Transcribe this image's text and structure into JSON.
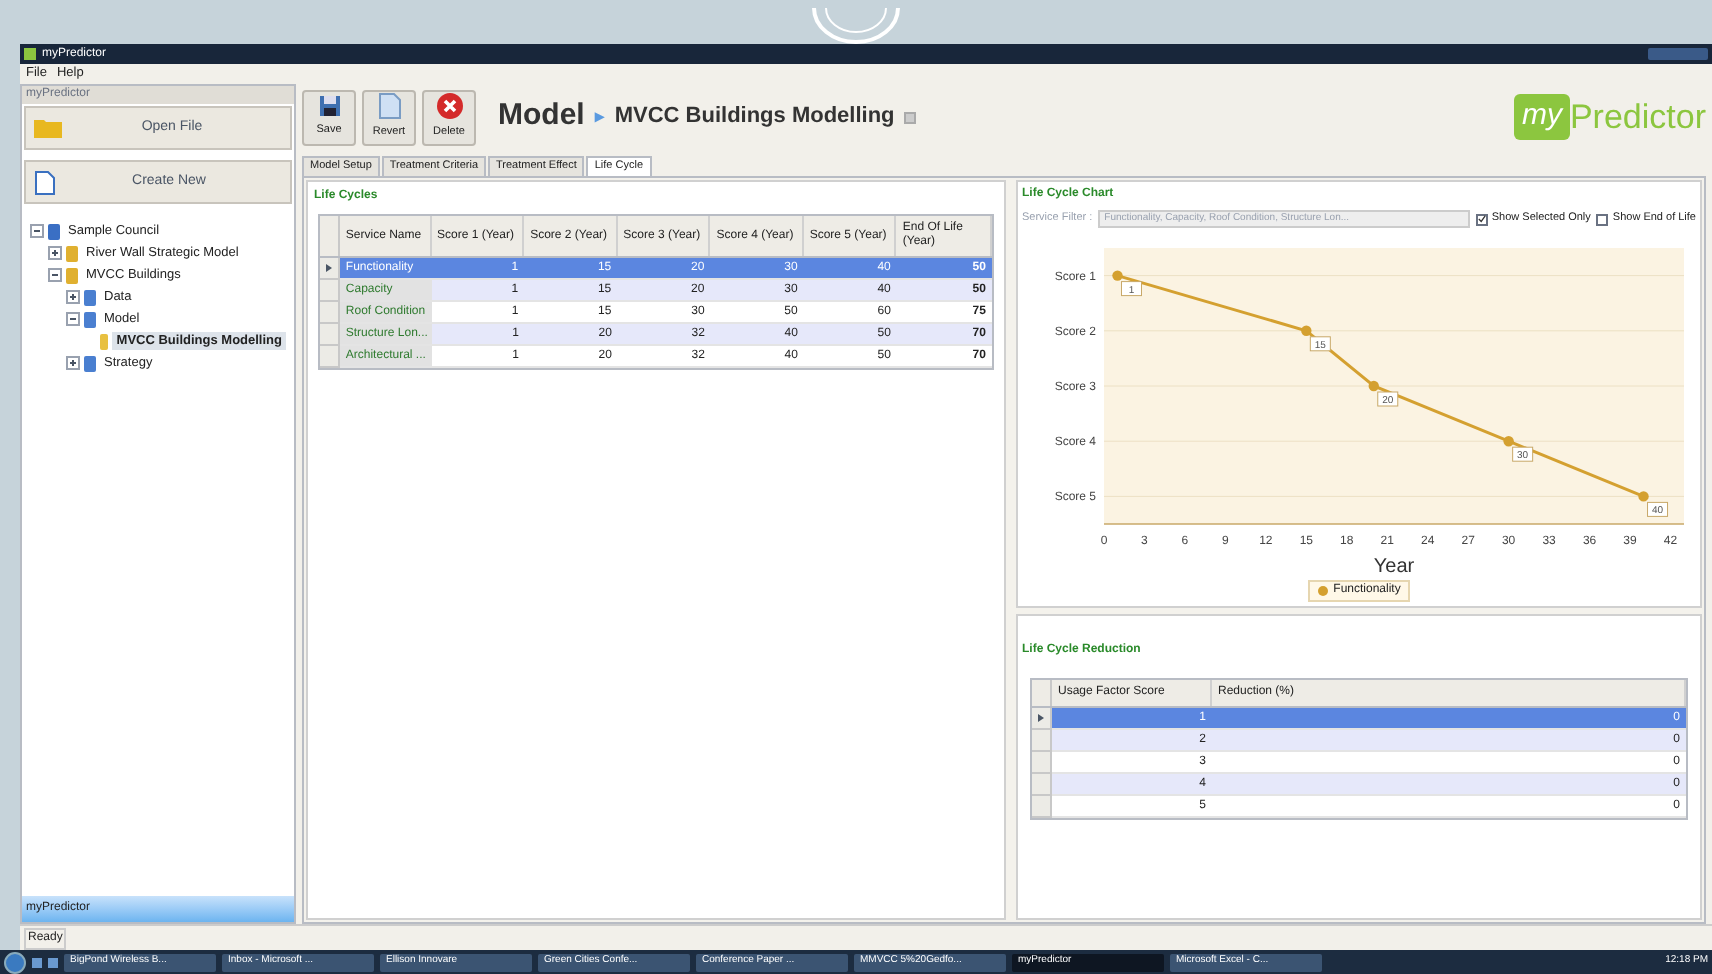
{
  "window": {
    "title": "myPredictor"
  },
  "menu": [
    {
      "label": "File"
    },
    {
      "label": "Help"
    }
  ],
  "sidebar": {
    "header": "myPredictor",
    "open_button": "Open File",
    "create_button": "Create New",
    "footer": "myPredictor",
    "tree": [
      {
        "label": "Sample Council",
        "kind": "root",
        "expanded": true,
        "selected": false,
        "children": [
          {
            "label": "River Wall Strategic Model",
            "kind": "folder",
            "expanded": false,
            "selected": false
          },
          {
            "label": "MVCC Buildings",
            "kind": "folder",
            "expanded": true,
            "selected": false,
            "children": [
              {
                "label": "Data",
                "kind": "group",
                "expanded": false,
                "selected": false
              },
              {
                "label": "Model",
                "kind": "group",
                "expanded": true,
                "selected": false,
                "children": [
                  {
                    "label": "MVCC Buildings Modelling",
                    "kind": "doc",
                    "expanded": false,
                    "selected": true
                  }
                ]
              },
              {
                "label": "Strategy",
                "kind": "group",
                "expanded": false,
                "selected": false
              }
            ]
          }
        ]
      }
    ]
  },
  "toolbar": [
    {
      "label": "Save",
      "kind": "save"
    },
    {
      "label": "Revert",
      "kind": "revert"
    },
    {
      "label": "Delete",
      "kind": "delete"
    }
  ],
  "breadcrumb": {
    "section": "Model",
    "separator": "▸",
    "page": "MVCC Buildings Modelling"
  },
  "logo": {
    "prefix": "my",
    "name": "Predictor"
  },
  "tabs": [
    {
      "label": "Model Setup",
      "selected": false
    },
    {
      "label": "Treatment Criteria",
      "selected": false
    },
    {
      "label": "Treatment Effect",
      "selected": false
    },
    {
      "label": "Life Cycle",
      "selected": true
    }
  ],
  "life_cycles": {
    "title": "Life Cycles",
    "columns": [
      "Service Name",
      "Score 1 (Year)",
      "Score 2 (Year)",
      "Score 3 (Year)",
      "Score 4 (Year)",
      "Score 5 (Year)",
      "End Of Life (Year)"
    ],
    "rows": [
      {
        "selected": true,
        "cells": [
          "Functionality",
          "1",
          "15",
          "20",
          "30",
          "40",
          "50"
        ]
      },
      {
        "selected": false,
        "cells": [
          "Capacity",
          "1",
          "15",
          "20",
          "30",
          "40",
          "50"
        ]
      },
      {
        "selected": false,
        "cells": [
          "Roof Condition",
          "1",
          "15",
          "30",
          "50",
          "60",
          "75"
        ]
      },
      {
        "selected": false,
        "cells": [
          "Structure Lon...",
          "1",
          "20",
          "32",
          "40",
          "50",
          "70"
        ]
      },
      {
        "selected": false,
        "cells": [
          "Architectural ...",
          "1",
          "20",
          "32",
          "40",
          "50",
          "70"
        ]
      }
    ]
  },
  "life_cycle_chart": {
    "title": "Life Cycle Chart",
    "filter_label": "Service Filter :",
    "filter_value": "Functionality, Capacity, Roof Condition, Structure Lon...",
    "filter_disabled": true,
    "options": [
      {
        "label": "Show Selected Only",
        "checked": true
      },
      {
        "label": "Show End of Life",
        "checked": false
      }
    ],
    "chart_data": {
      "type": "line",
      "orientation": "horizontal",
      "xlabel": "Year",
      "categories": [
        "Score 1",
        "Score 2",
        "Score 3",
        "Score 4",
        "Score 5"
      ],
      "series": [
        {
          "name": "Functionality",
          "color": "#d4a030",
          "marker": "circle",
          "values": [
            1,
            15,
            20,
            30,
            40
          ]
        }
      ],
      "grid": true,
      "xlim": [
        0,
        43
      ],
      "xticks": [
        0,
        3,
        6,
        9,
        12,
        15,
        18,
        21,
        24,
        27,
        30,
        33,
        36,
        39,
        42
      ],
      "data_labels": true
    }
  },
  "life_cycle_reduction": {
    "title": "Life Cycle Reduction",
    "columns": [
      "Usage Factor Score",
      "Reduction (%)"
    ],
    "rows": [
      {
        "selected": true,
        "cells": [
          "1",
          "0"
        ]
      },
      {
        "selected": false,
        "cells": [
          "2",
          "0"
        ]
      },
      {
        "selected": false,
        "cells": [
          "3",
          "0"
        ]
      },
      {
        "selected": false,
        "cells": [
          "4",
          "0"
        ]
      },
      {
        "selected": false,
        "cells": [
          "5",
          "0"
        ]
      }
    ]
  },
  "status_bar": "Ready",
  "taskbar": {
    "items": [
      {
        "label": "BigPond Wireless B...",
        "selected": false
      },
      {
        "label": "Inbox - Microsoft ...",
        "selected": false
      },
      {
        "label": "Ellison Innovare",
        "selected": false
      },
      {
        "label": "Green Cities Confe...",
        "selected": false
      },
      {
        "label": "Conference Paper ...",
        "selected": false
      },
      {
        "label": "MMVCC 5%20Gedfo...",
        "selected": false
      },
      {
        "label": "myPredictor",
        "selected": true
      },
      {
        "label": "Microsoft Excel - C...",
        "selected": false
      }
    ],
    "clock": "12:18 PM"
  }
}
